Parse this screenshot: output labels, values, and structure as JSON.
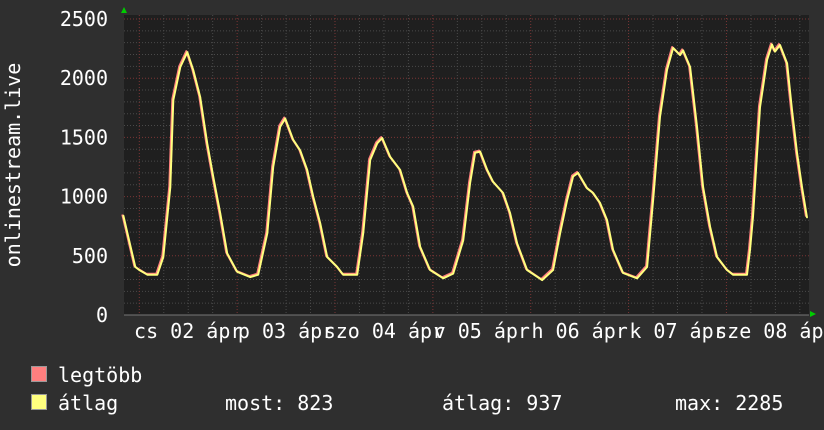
{
  "chart_data": {
    "type": "line",
    "ylabel": "onlinestream.live",
    "ylim": [
      0,
      2500
    ],
    "yticks": [
      0,
      500,
      1000,
      1500,
      2000,
      2500
    ],
    "xlim": [
      "04-01 20:15",
      "04-08 20:15"
    ],
    "xtick_labels": [
      {
        "at": "04-02 12:00",
        "label": "cs 02 ápr"
      },
      {
        "at": "04-03 12:00",
        "label": "p 03 ápr"
      },
      {
        "at": "04-04 12:00",
        "label": "szo 04 ápr"
      },
      {
        "at": "04-05 12:00",
        "label": "v 05 ápr"
      },
      {
        "at": "04-06 12:00",
        "label": "h 06 ápr"
      },
      {
        "at": "04-07 12:00",
        "label": "k 07 ápr"
      },
      {
        "at": "04-08 12:00",
        "label": "sze 08 ápr"
      }
    ],
    "grid": true,
    "legend_placement": "bottom-left",
    "series": [
      {
        "name": "legtöbb",
        "color": "#ff7f7f"
      },
      {
        "name": "átlag",
        "color": "#ffff7f"
      }
    ],
    "points": [
      [
        "04-01 20:05",
        840
      ],
      [
        "04-01 23:01",
        405
      ],
      [
        "04-02 00:00",
        380
      ],
      [
        "04-02 01:58",
        340
      ],
      [
        "04-02 04:25",
        340
      ],
      [
        "04-02 05:53",
        490
      ],
      [
        "04-02 07:36",
        1080
      ],
      [
        "04-02 08:20",
        1815
      ],
      [
        "04-02 10:03",
        2095
      ],
      [
        "04-02 11:46",
        2220
      ],
      [
        "04-02 13:14",
        2070
      ],
      [
        "04-02 14:57",
        1840
      ],
      [
        "04-02 16:40",
        1450
      ],
      [
        "04-02 18:08",
        1170
      ],
      [
        "04-02 19:51",
        860
      ],
      [
        "04-02 21:34",
        520
      ],
      [
        "04-03 00:01",
        365
      ],
      [
        "04-03 03:13",
        320
      ],
      [
        "04-03 05:10",
        340
      ],
      [
        "04-03 07:23",
        690
      ],
      [
        "04-03 08:51",
        1250
      ],
      [
        "04-03 10:34",
        1590
      ],
      [
        "04-03 11:47",
        1660
      ],
      [
        "04-03 13:45",
        1480
      ],
      [
        "04-03 15:28",
        1390
      ],
      [
        "04-03 17:11",
        1225
      ],
      [
        "04-03 18:39",
        1000
      ],
      [
        "04-03 20:22",
        775
      ],
      [
        "04-03 22:05",
        490
      ],
      [
        "04-04 00:32",
        405
      ],
      [
        "04-04 02:01",
        340
      ],
      [
        "04-04 05:26",
        340
      ],
      [
        "04-04 06:55",
        690
      ],
      [
        "04-04 08:38",
        1310
      ],
      [
        "04-04 10:21",
        1450
      ],
      [
        "04-04 11:34",
        1495
      ],
      [
        "04-04 13:32",
        1335
      ],
      [
        "04-04 15:59",
        1225
      ],
      [
        "04-04 17:42",
        1030
      ],
      [
        "04-04 19:10",
        915
      ],
      [
        "04-04 20:53",
        575
      ],
      [
        "04-04 23:20",
        380
      ],
      [
        "04-05 02:32",
        310
      ],
      [
        "04-05 04:59",
        350
      ],
      [
        "04-05 07:26",
        630
      ],
      [
        "04-05 09:08",
        1115
      ],
      [
        "04-05 10:22",
        1370
      ],
      [
        "04-05 11:36",
        1380
      ],
      [
        "04-05 13:19",
        1225
      ],
      [
        "04-05 14:47",
        1125
      ],
      [
        "04-05 17:14",
        1030
      ],
      [
        "04-05 18:57",
        860
      ],
      [
        "04-05 20:40",
        605
      ],
      [
        "04-05 23:07",
        380
      ],
      [
        "04-06 02:48",
        295
      ],
      [
        "04-06 05:29",
        380
      ],
      [
        "04-06 07:13",
        690
      ],
      [
        "04-06 08:56",
        970
      ],
      [
        "04-06 10:24",
        1170
      ],
      [
        "04-06 11:37",
        1200
      ],
      [
        "04-06 13:50",
        1070
      ],
      [
        "04-06 15:18",
        1030
      ],
      [
        "04-06 17:01",
        945
      ],
      [
        "04-06 18:44",
        800
      ],
      [
        "04-06 20:12",
        550
      ],
      [
        "04-06 22:39",
        355
      ],
      [
        "04-07 02:05",
        310
      ],
      [
        "04-07 04:32",
        405
      ],
      [
        "04-07 06:01",
        970
      ],
      [
        "04-07 07:43",
        1675
      ],
      [
        "04-07 09:26",
        2070
      ],
      [
        "04-07 10:55",
        2255
      ],
      [
        "04-07 12:38",
        2195
      ],
      [
        "04-07 13:22",
        2235
      ],
      [
        "04-07 15:05",
        2095
      ],
      [
        "04-07 16:47",
        1590
      ],
      [
        "04-07 18:16",
        1080
      ],
      [
        "04-07 19:59",
        745
      ],
      [
        "04-07 21:42",
        490
      ],
      [
        "04-08 00:09",
        380
      ],
      [
        "04-08 01:37",
        340
      ],
      [
        "04-08 05:03",
        340
      ],
      [
        "04-08 05:47",
        550
      ],
      [
        "04-08 06:31",
        830
      ],
      [
        "04-08 08:14",
        1755
      ],
      [
        "04-08 09:58",
        2155
      ],
      [
        "04-08 11:11",
        2285
      ],
      [
        "04-08 11:55",
        2225
      ],
      [
        "04-08 13:08",
        2280
      ],
      [
        "04-08 14:52",
        2125
      ],
      [
        "04-08 16:05",
        1730
      ],
      [
        "04-08 17:19",
        1370
      ],
      [
        "04-08 18:32",
        1080
      ],
      [
        "04-08 19:46",
        823
      ]
    ]
  },
  "legend": {
    "max_label": "legtöbb",
    "avg_label": "átlag",
    "current": "most: 823",
    "average": "átlag: 937",
    "maximum": "max: 2285"
  },
  "colors": {
    "background": "#2f2f2f",
    "plot_bg": "#1f1f1f",
    "major_grid": "#8a3a3a",
    "minor_grid": "#555555",
    "arrow": "#00cc00"
  }
}
